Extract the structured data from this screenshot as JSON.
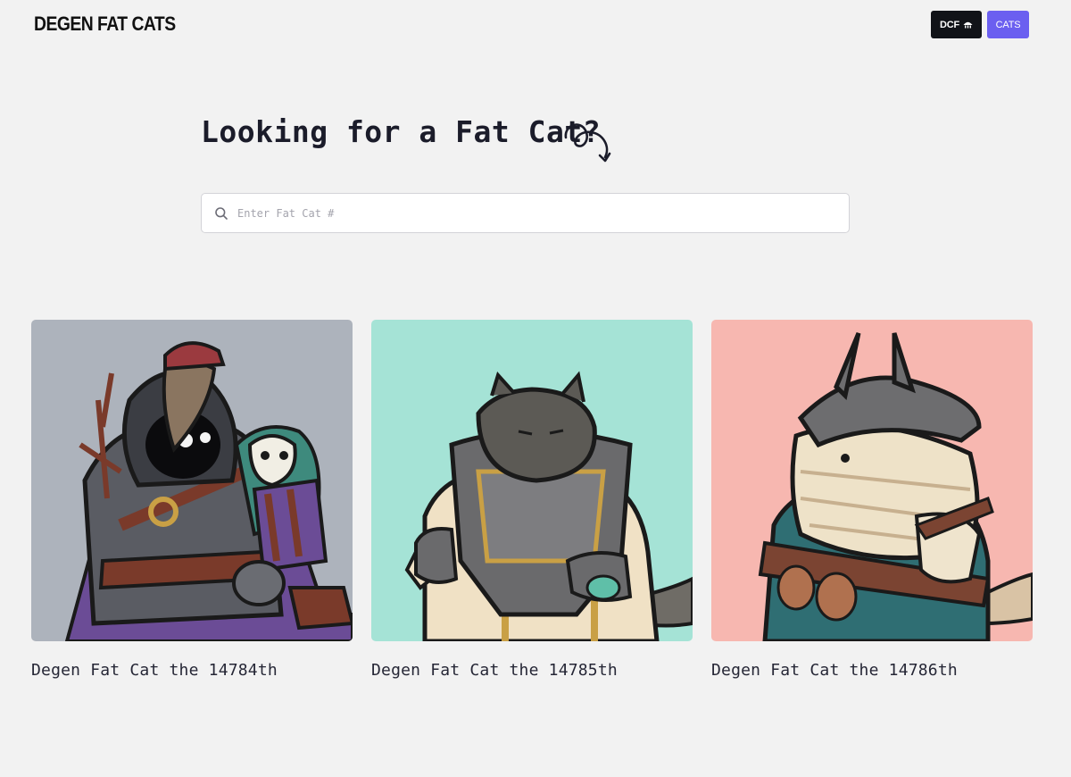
{
  "header": {
    "logo": "DEGEN FAT CATS",
    "nav": {
      "dcf_label": "DCF",
      "dcf_icon": "umbrella-icon",
      "cats_label": "CATS"
    },
    "colors": {
      "dcf_bg": "#111318",
      "cats_bg": "#6b5ff0"
    }
  },
  "hero": {
    "title": "Looking for a Fat Cat?",
    "decoration": "squiggle-arrow-icon"
  },
  "search": {
    "placeholder": "Enter Fat Cat #",
    "icon": "search-icon"
  },
  "cats": [
    {
      "name": "Degen Fat Cat the 14784th",
      "background": "#adb3bc",
      "art": "plague-doctor-cat"
    },
    {
      "name": "Degen Fat Cat the 14785th",
      "background": "#a5e3d6",
      "art": "armored-grey-cat"
    },
    {
      "name": "Degen Fat Cat the 14786th",
      "background": "#f7b7b0",
      "art": "horned-helmet-cat"
    }
  ]
}
